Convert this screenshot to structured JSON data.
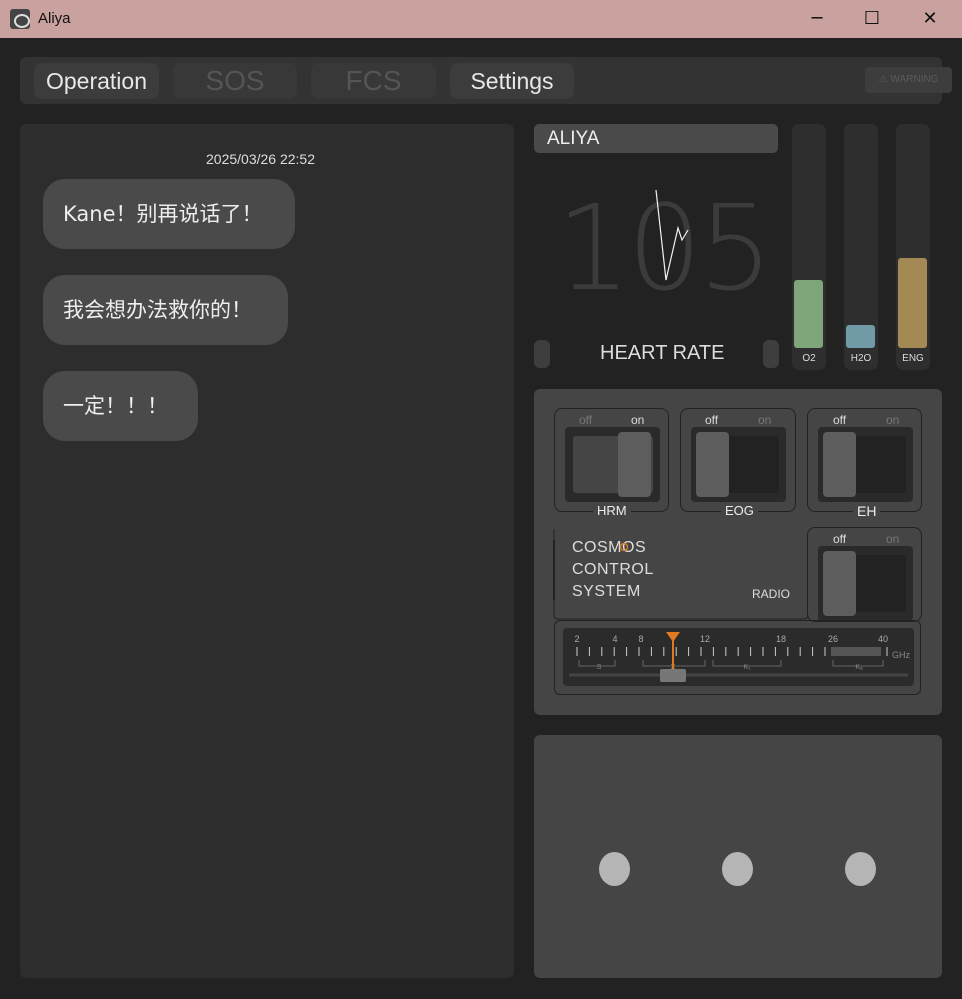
{
  "window": {
    "title": "Aliya",
    "minimize_glyph": "─",
    "maximize_glyph": "☐",
    "close_glyph": "✕"
  },
  "tabs": [
    {
      "label": "Operation",
      "active": true
    },
    {
      "label": "SOS",
      "active": false
    },
    {
      "label": "FCS",
      "active": false
    },
    {
      "label": "Settings",
      "active": true
    }
  ],
  "warning_label": "⚠ WARNING",
  "chat": {
    "timestamp": "2025/03/26  22:52",
    "messages": [
      "Kane！别再说话了！",
      "我会想办法救你的！",
      "一定！！！"
    ]
  },
  "vitals": {
    "name": "ALIYA",
    "heart_rate_value": "105",
    "heart_rate_label": "HEART RATE",
    "gauges": [
      {
        "label": "O2",
        "level": 0.3,
        "color": "#7fa57a"
      },
      {
        "label": "H2O",
        "level": 0.1,
        "color": "#6f9aa6"
      },
      {
        "label": "ENG",
        "level": 0.4,
        "color": "#a38a55"
      }
    ]
  },
  "controls": {
    "switches": [
      {
        "id": "hrm",
        "label": "HRM",
        "off_label": "off",
        "on_label": "on",
        "state": "on"
      },
      {
        "id": "eog",
        "label": "EOG",
        "off_label": "off",
        "on_label": "on",
        "state": "off"
      },
      {
        "id": "eh",
        "label": "EH",
        "off_label": "off",
        "on_label": "on",
        "state": "off"
      },
      {
        "id": "radio",
        "label": "RADIO",
        "off_label": "off",
        "on_label": "on",
        "state": "off"
      }
    ],
    "system_lines": [
      "COSMOS",
      "CONTROL",
      "SYSTEM"
    ],
    "frequency": {
      "ticks": [
        "2",
        "4",
        "8",
        "12",
        "18",
        "26",
        "40"
      ],
      "unit": "GHz",
      "band_labels": [
        "S",
        "X",
        "K₁",
        "Kₐ"
      ],
      "value_ghz": 10
    }
  },
  "accent_color": "#e07a1f"
}
